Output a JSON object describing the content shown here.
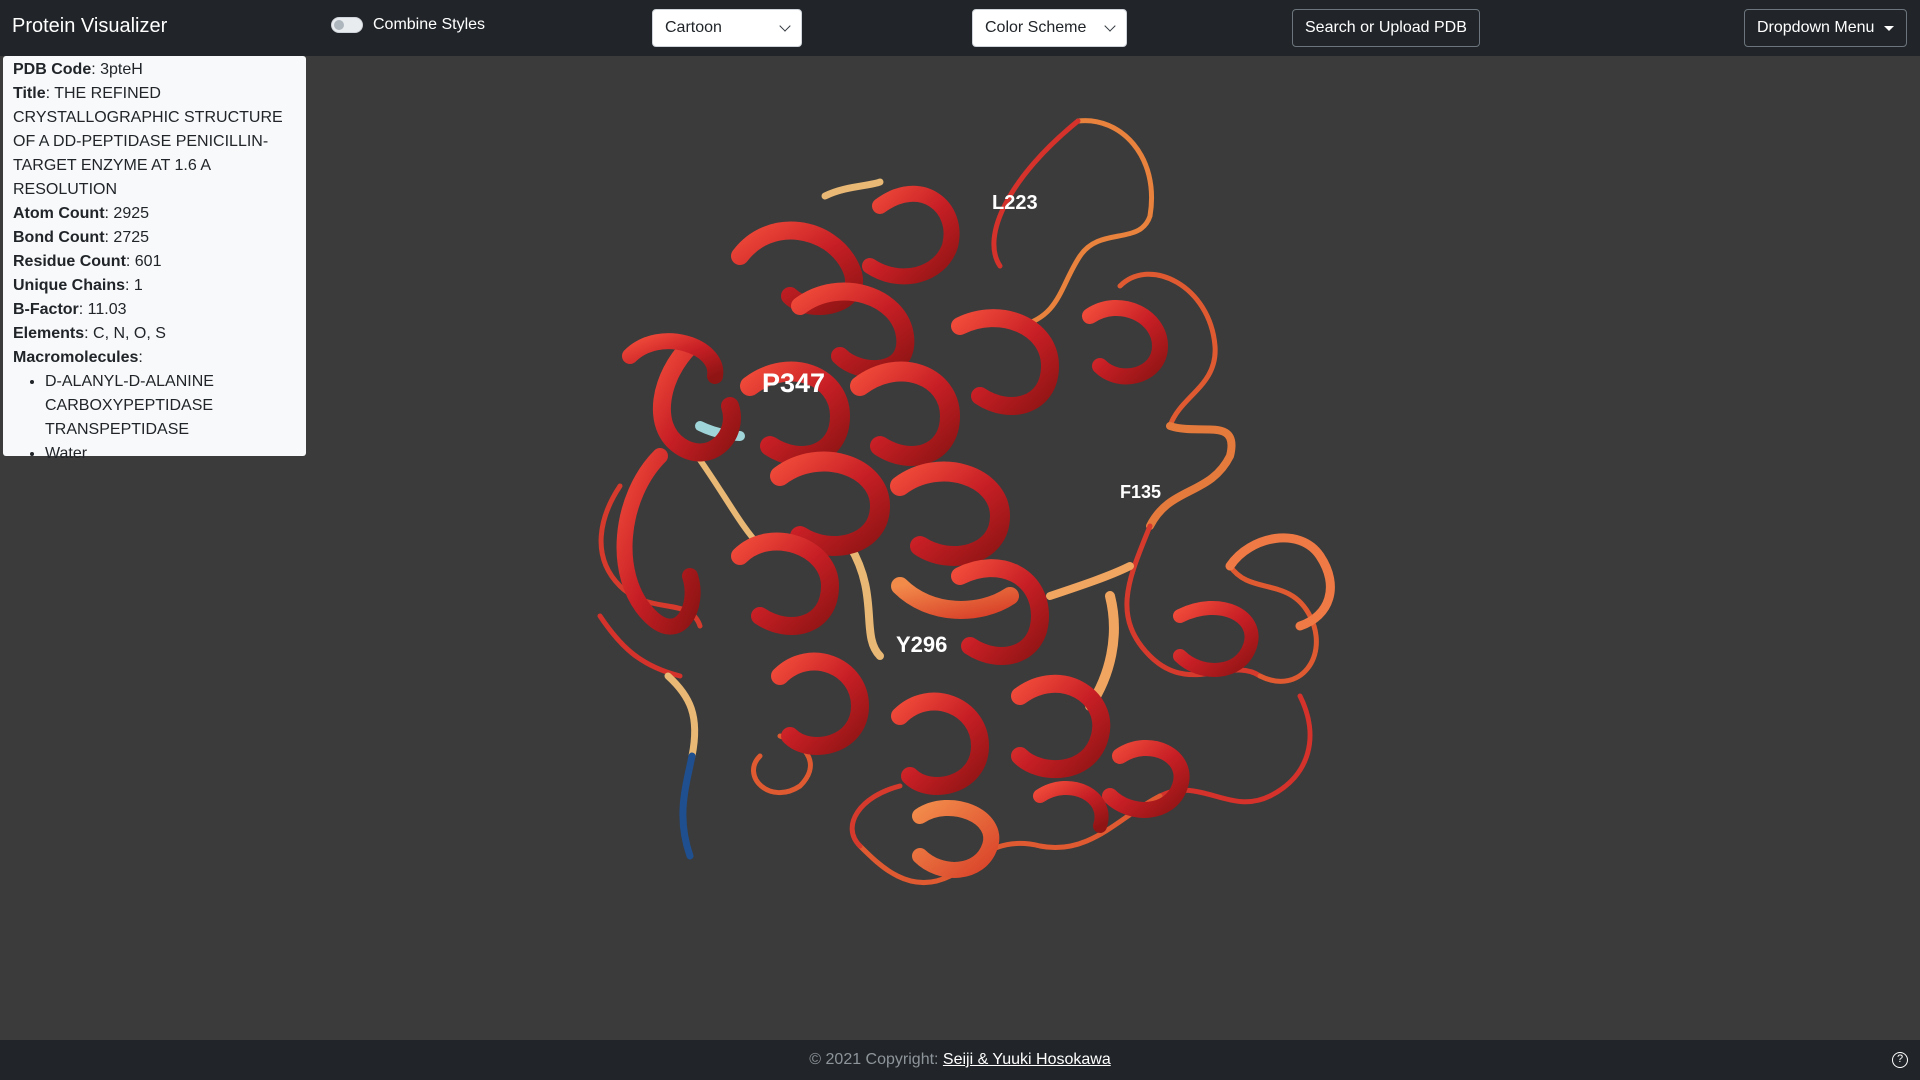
{
  "navbar": {
    "brand": "Protein Visualizer",
    "toggle_label": "Combine Styles",
    "style_select": "Cartoon",
    "color_select": "Color Scheme",
    "search_button": "Search or Upload PDB",
    "dropdown_menu": "Dropdown Menu"
  },
  "info": {
    "pdb_code_label": "PDB Code",
    "pdb_code": "3pteH",
    "title_label": "Title",
    "title": "THE REFINED CRYSTALLOGRAPHIC STRUCTURE OF A DD-PEPTIDASE PENICILLIN-TARGET ENZYME AT 1.6 A RESOLUTION",
    "atom_count_label": "Atom Count",
    "atom_count": "2925",
    "bond_count_label": "Bond Count",
    "bond_count": "2725",
    "residue_count_label": "Residue Count",
    "residue_count": "601",
    "unique_chains_label": "Unique Chains",
    "unique_chains": "1",
    "bfactor_label": "B-Factor",
    "bfactor": "11.03",
    "elements_label": "Elements",
    "elements": "C, N, O, S",
    "macromolecules_label": "Macromolecules",
    "macromolecules": [
      "D-ALANYL-D-ALANINE CARBOXYPEPTIDASE TRANSPEPTIDASE",
      "Water"
    ]
  },
  "viewer": {
    "labels": {
      "l223": "L223",
      "p347": "P347",
      "f135": "F135",
      "y296": "Y296"
    },
    "colors": {
      "background": "#3b3b3b",
      "helix": "#d42a2a",
      "loop": "#e25a2c",
      "warm": "#e8a15f",
      "cool": "#9fd4d9",
      "blue": "#1f4f8f"
    }
  },
  "footer": {
    "copyright": "© 2021 Copyright: ",
    "authors": "Seiji & Yuuki Hosokawa",
    "help_icon": "?"
  }
}
